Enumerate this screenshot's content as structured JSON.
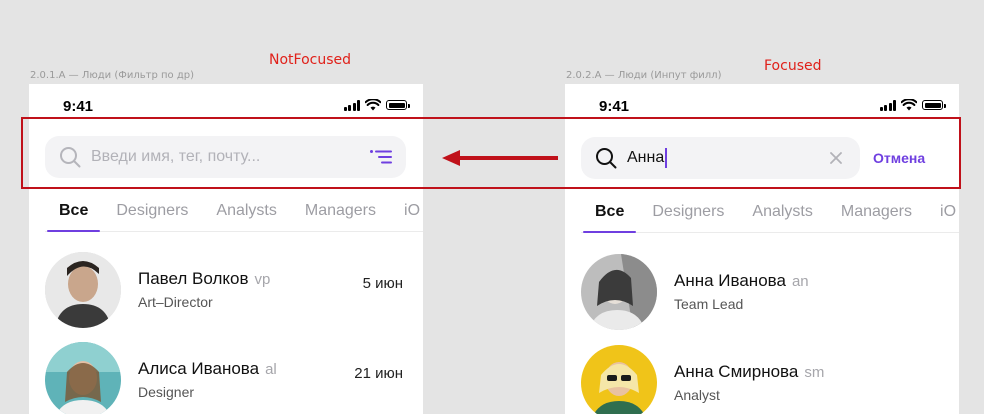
{
  "annotations": {
    "left_caption": "2.0.1.A — Люди (Фильтр по др)",
    "right_caption": "2.0.2.A — Люди (Инпут филл)",
    "left_state": "NotFocused",
    "right_state": "Focused",
    "highlight_color": "#c0111a"
  },
  "left_screen": {
    "status_time": "9:41",
    "search": {
      "placeholder": "Введи имя, тег, почту...",
      "value": ""
    },
    "tabs": [
      "Все",
      "Designers",
      "Analysts",
      "Managers",
      "iO"
    ],
    "active_tab": "Все",
    "people": [
      {
        "name": "Павел Волков",
        "tag": "vp",
        "role": "Art–Director",
        "date": "5 июн"
      },
      {
        "name": "Алиса Иванова",
        "tag": "al",
        "role": "Designer",
        "date": "21 июн"
      }
    ]
  },
  "right_screen": {
    "status_time": "9:41",
    "search": {
      "value": "Анна",
      "cancel_label": "Отмена"
    },
    "tabs": [
      "Все",
      "Designers",
      "Analysts",
      "Managers",
      "iO"
    ],
    "active_tab": "Все",
    "people": [
      {
        "name": "Анна Иванова",
        "tag": "an",
        "role": "Team Lead"
      },
      {
        "name": "Анна Смирнова",
        "tag": "sm",
        "role": "Analyst"
      }
    ]
  },
  "colors": {
    "accent": "#6f3fe0",
    "annotation_red": "#e0211a",
    "background": "#e4e4e4"
  }
}
